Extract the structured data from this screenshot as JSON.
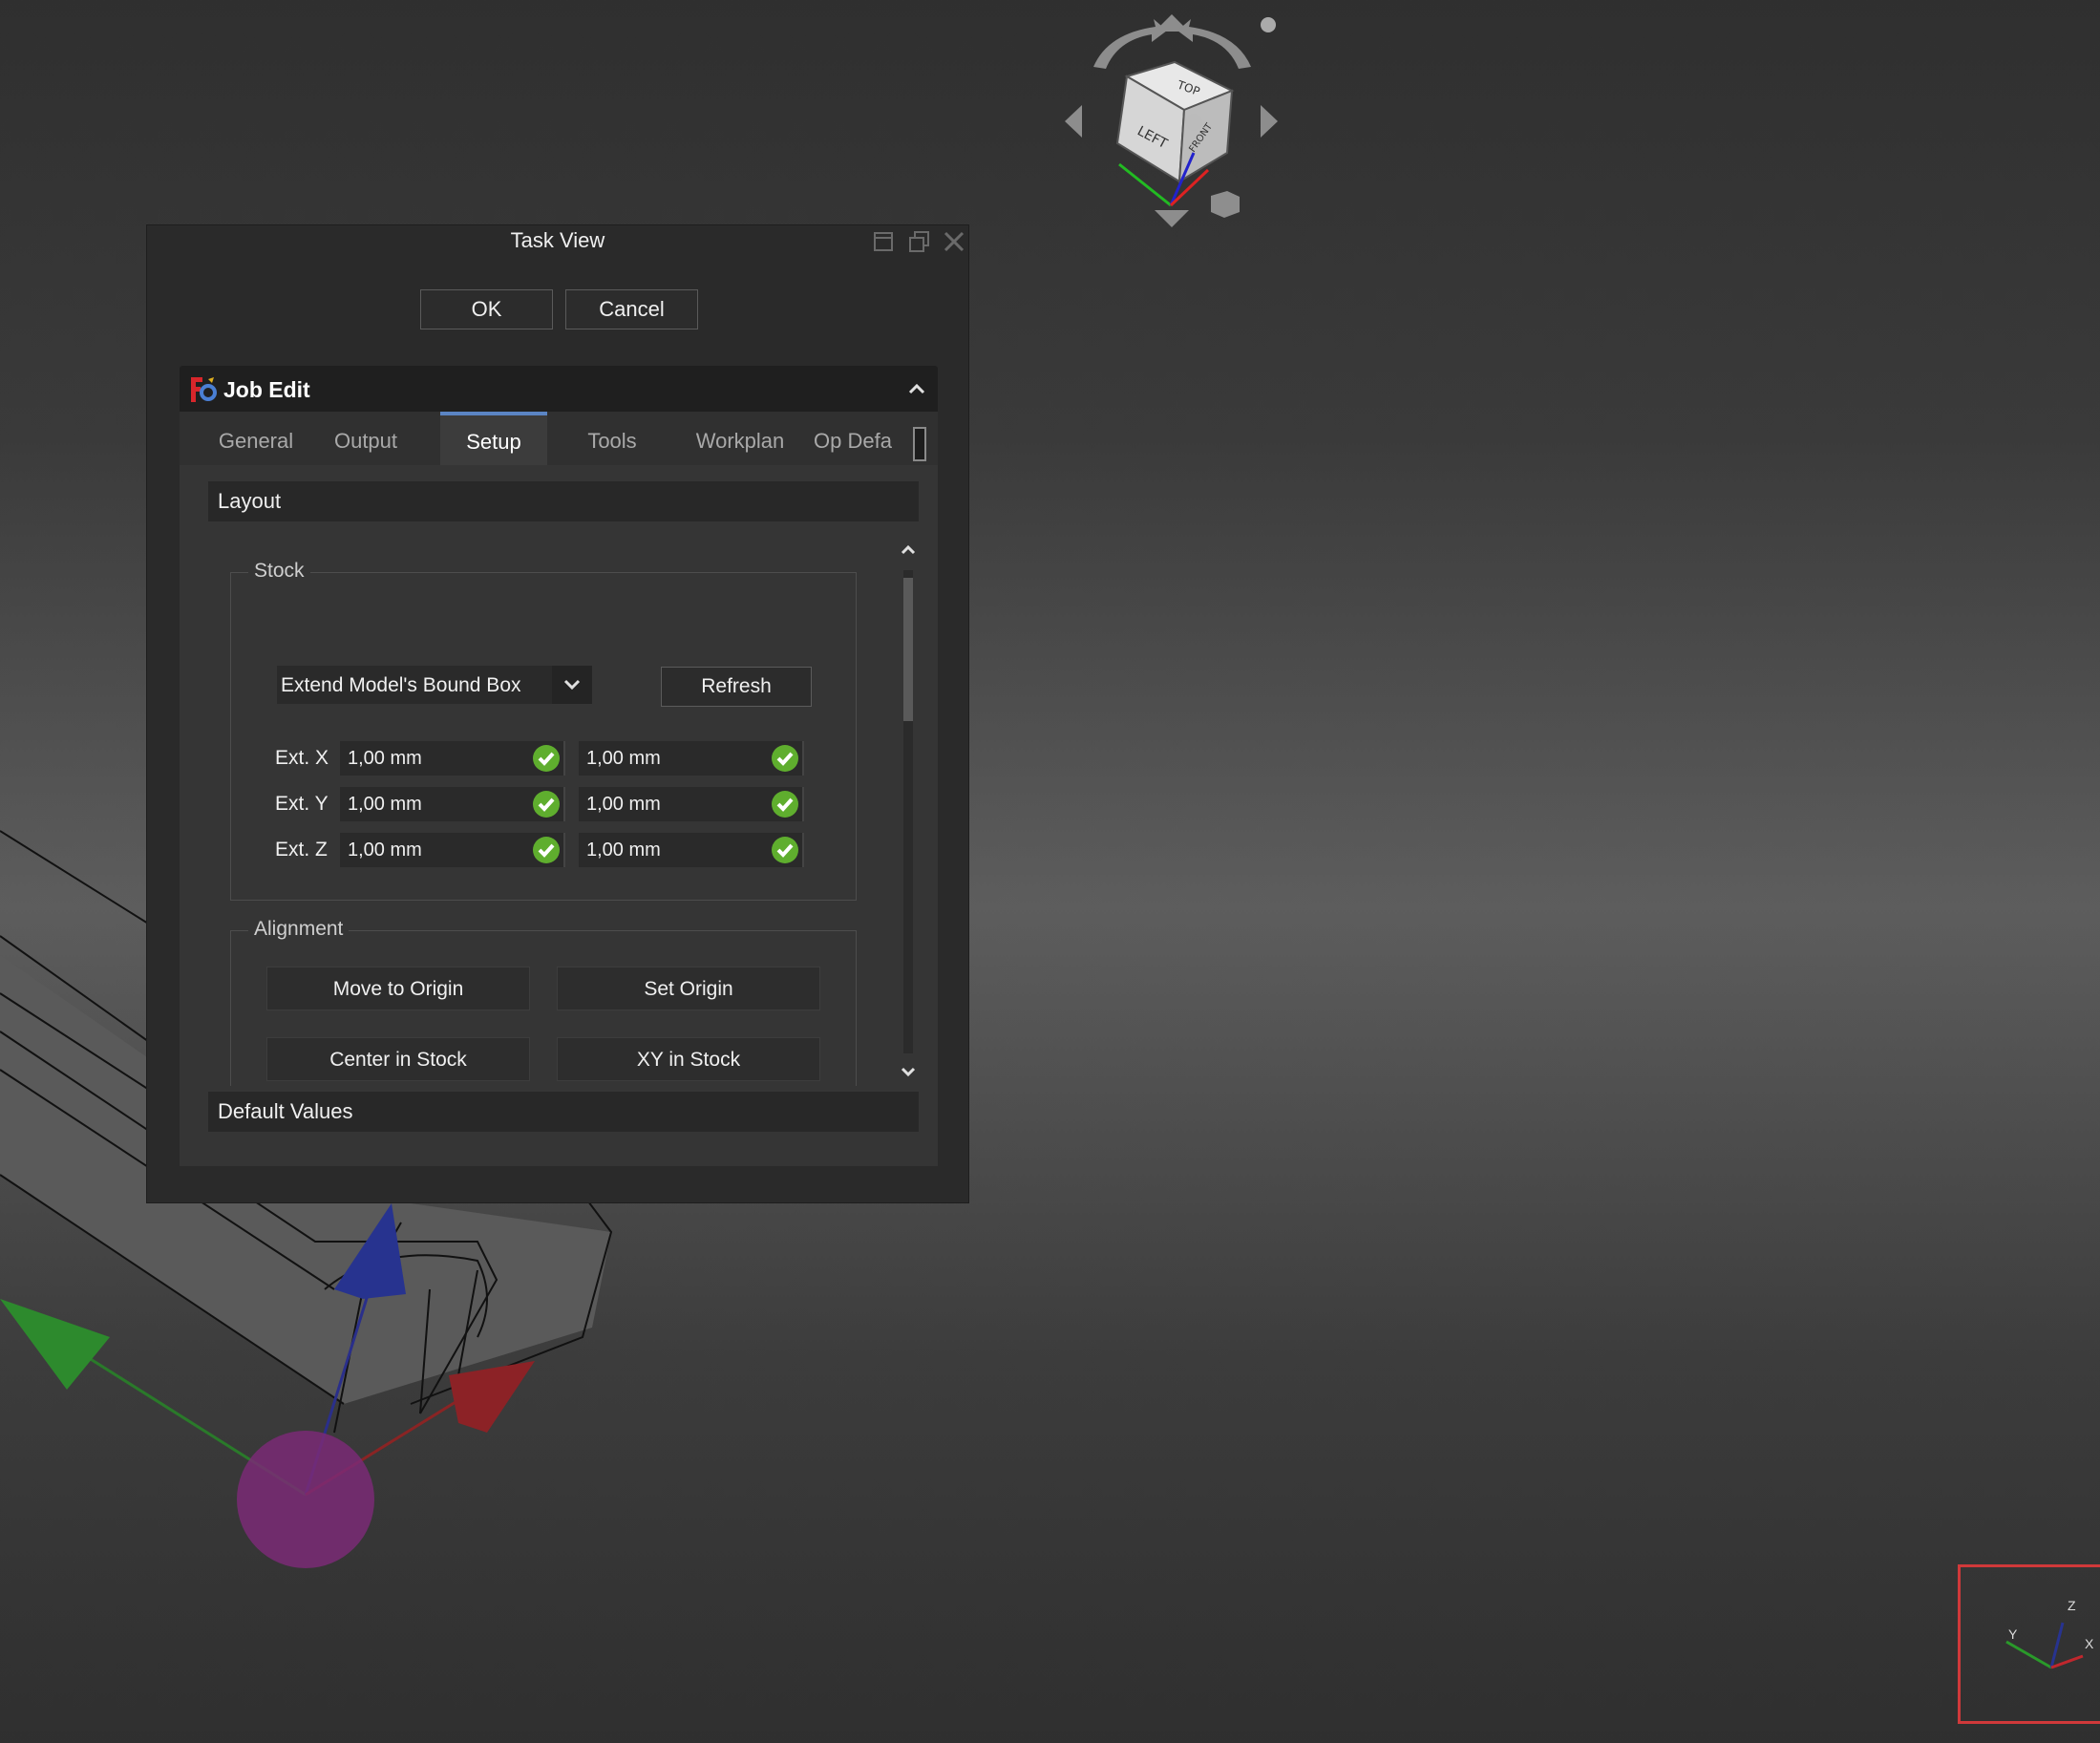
{
  "task_view": {
    "title": "Task View",
    "ok_label": "OK",
    "cancel_label": "Cancel"
  },
  "job_edit": {
    "title": "Job Edit",
    "tabs": [
      {
        "label": "General"
      },
      {
        "label": "Output"
      },
      {
        "label": "Setup"
      },
      {
        "label": "Tools"
      },
      {
        "label": "Workplan"
      },
      {
        "label": "Op Defa"
      }
    ],
    "active_tab": "Setup",
    "layout_section": "Layout",
    "default_values_section": "Default Values",
    "stock": {
      "title": "Stock",
      "type": "Extend Model's Bound Box",
      "refresh_label": "Refresh",
      "rows": [
        {
          "label": "Ext. X",
          "neg": "1,00 mm",
          "pos": "1,00 mm"
        },
        {
          "label": "Ext. Y",
          "neg": "1,00 mm",
          "pos": "1,00 mm"
        },
        {
          "label": "Ext. Z",
          "neg": "1,00 mm",
          "pos": "1,00 mm"
        }
      ]
    },
    "alignment": {
      "title": "Alignment",
      "move_to_origin": "Move to Origin",
      "set_origin": "Set Origin",
      "center_in_stock": "Center in Stock",
      "xy_in_stock": "XY in Stock"
    }
  },
  "nav_cube": {
    "face_left": "LEFT",
    "face_top": "TOP",
    "face_front": "FRONT"
  },
  "axis_indicator": {
    "x": "X",
    "y": "Y",
    "z": "Z"
  },
  "colors": {
    "accent_tab": "#5b85c4",
    "check_green": "#5fae2e",
    "axis_x": "#c0272d",
    "axis_y": "#2a9a2a",
    "axis_z": "#27338f",
    "highlight_box": "#d0393a"
  }
}
